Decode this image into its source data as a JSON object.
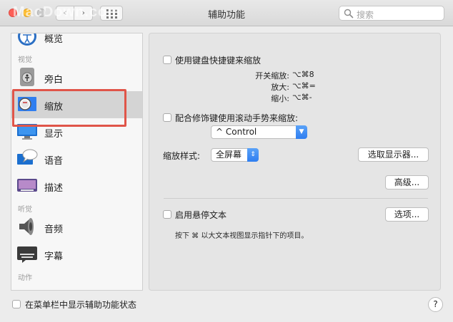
{
  "window": {
    "title": "辅助功能",
    "watermark": "MacDown.com",
    "nav_back": "‹",
    "nav_forward": "›"
  },
  "search": {
    "placeholder": "搜索",
    "value": ""
  },
  "sidebar": {
    "partial_top_item": "概览",
    "sections": [
      {
        "header": "视觉"
      },
      {
        "header": "听觉"
      },
      {
        "header": "动作"
      }
    ],
    "items": [
      {
        "label": "旁白",
        "icon": "voiceover-icon"
      },
      {
        "label": "缩放",
        "icon": "zoom-icon",
        "selected": true
      },
      {
        "label": "显示",
        "icon": "display-icon"
      },
      {
        "label": "语音",
        "icon": "speech-icon"
      },
      {
        "label": "描述",
        "icon": "descriptions-icon"
      },
      {
        "label": "音频",
        "icon": "speaker-icon"
      },
      {
        "label": "字幕",
        "icon": "captions-icon"
      }
    ],
    "highlight_color": "#e05549"
  },
  "zoom": {
    "keyboard_shortcuts": {
      "label": "使用键盘快捷键来缩放",
      "checked": false,
      "shortcuts": [
        {
          "name": "开关缩放:",
          "keys": "⌥⌘8"
        },
        {
          "name": "放大:",
          "keys": "⌥⌘="
        },
        {
          "name": "缩小:",
          "keys": "⌥⌘-"
        }
      ]
    },
    "scroll_gesture": {
      "label": "配合修饰键使用滚动手势来缩放:",
      "checked": false,
      "modifier": "^ Control"
    },
    "zoom_style": {
      "label": "缩放样式:",
      "value": "全屏幕"
    },
    "choose_display_button": "选取显示器...",
    "advanced_button": "高级...",
    "hover_text": {
      "label": "启用悬停文本",
      "checked": false,
      "options_button": "选项...",
      "note": "按下 ⌘ 以大文本视图显示指针下的项目。"
    }
  },
  "footer": {
    "show_in_menubar_label": "在菜单栏中显示辅助功能状态",
    "show_in_menubar_checked": false,
    "help": "?"
  },
  "colors": {
    "accent": "#2f7ef0",
    "highlight": "#e05549"
  }
}
